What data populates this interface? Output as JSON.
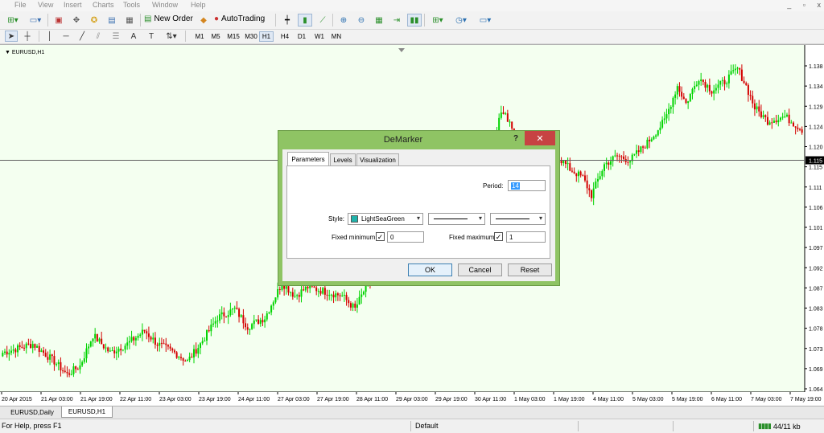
{
  "menu": [
    "File",
    "View",
    "Insert",
    "Charts",
    "Tools",
    "Window",
    "Help"
  ],
  "window_controls": [
    "_",
    "▫",
    "x"
  ],
  "toolbar": {
    "new_order_label": "New Order",
    "autotrading_label": "AutoTrading"
  },
  "timeframes": [
    "M1",
    "M5",
    "M15",
    "M30",
    "H1",
    "H4",
    "D1",
    "W1",
    "MN"
  ],
  "active_timeframe": "H1",
  "chart": {
    "label": "EURUSD,H1",
    "current_price": "1.115",
    "x_labels": [
      "20 Apr 2015",
      "21 Apr 03:00",
      "21 Apr 19:00",
      "22 Apr 11:00",
      "23 Apr 03:00",
      "23 Apr 19:00",
      "24 Apr 11:00",
      "27 Apr 03:00",
      "27 Apr 19:00",
      "28 Apr 11:00",
      "29 Apr 03:00",
      "29 Apr 19:00",
      "30 Apr 11:00",
      "1 May 03:00",
      "1 May 19:00",
      "4 May 11:00",
      "5 May 03:00",
      "5 May 19:00",
      "6 May 11:00",
      "7 May 03:00",
      "7 May 19:00"
    ],
    "y_labels": [
      "1.138",
      "1.134",
      "1.129",
      "1.124",
      "1.120",
      "1.115",
      "1.111",
      "1.106",
      "1.101",
      "1.097",
      "1.092",
      "1.087",
      "1.083",
      "1.078",
      "1.073",
      "1.069",
      "1.064"
    ],
    "colors": {
      "background": "#f4fff0",
      "bull": "#00d400",
      "bear": "#d40000",
      "grid": "#606060"
    }
  },
  "chart_data": {
    "type": "candlestick",
    "symbol": "EURUSD",
    "timeframe": "H1",
    "ylim": [
      1.062,
      1.141
    ],
    "current_price": 1.115,
    "anchors_close": [
      [
        0,
        1.071
      ],
      [
        14,
        1.073
      ],
      [
        24,
        1.069
      ],
      [
        30,
        1.066
      ],
      [
        36,
        1.068
      ],
      [
        42,
        1.075
      ],
      [
        50,
        1.071
      ],
      [
        58,
        1.073
      ],
      [
        66,
        1.076
      ],
      [
        72,
        1.073
      ],
      [
        80,
        1.071
      ],
      [
        86,
        1.069
      ],
      [
        92,
        1.073
      ],
      [
        100,
        1.079
      ],
      [
        108,
        1.081
      ],
      [
        114,
        1.077
      ],
      [
        122,
        1.079
      ],
      [
        130,
        1.087
      ],
      [
        136,
        1.084
      ],
      [
        142,
        1.086
      ],
      [
        150,
        1.085
      ],
      [
        158,
        1.084
      ],
      [
        164,
        1.081
      ],
      [
        170,
        1.087
      ],
      [
        176,
        1.089
      ],
      [
        182,
        1.09
      ],
      [
        190,
        1.091
      ],
      [
        200,
        1.099
      ],
      [
        210,
        1.104
      ],
      [
        218,
        1.112
      ],
      [
        228,
        1.119
      ],
      [
        232,
        1.126
      ],
      [
        236,
        1.124
      ],
      [
        240,
        1.119
      ],
      [
        246,
        1.117
      ],
      [
        252,
        1.114
      ],
      [
        258,
        1.116
      ],
      [
        264,
        1.113
      ],
      [
        270,
        1.111
      ],
      [
        274,
        1.107
      ],
      [
        280,
        1.114
      ],
      [
        286,
        1.116
      ],
      [
        292,
        1.115
      ],
      [
        300,
        1.119
      ],
      [
        308,
        1.124
      ],
      [
        314,
        1.132
      ],
      [
        318,
        1.128
      ],
      [
        324,
        1.134
      ],
      [
        330,
        1.131
      ],
      [
        336,
        1.133
      ],
      [
        342,
        1.136
      ],
      [
        346,
        1.132
      ],
      [
        350,
        1.127
      ],
      [
        356,
        1.124
      ],
      [
        364,
        1.125
      ],
      [
        372,
        1.122
      ]
    ]
  },
  "dialog": {
    "title": "DeMarker",
    "help": "?",
    "tabs": [
      "Parameters",
      "Levels",
      "Visualization"
    ],
    "active_tab": "Parameters",
    "period_label": "Period:",
    "period_value": "14",
    "style_label": "Style:",
    "style_color_name": "LightSeaGreen",
    "style_color": "#20b2aa",
    "fixed_min_label": "Fixed minimum",
    "fixed_min_checked": true,
    "fixed_min_value": "0",
    "fixed_max_label": "Fixed maximum",
    "fixed_max_checked": true,
    "fixed_max_value": "1",
    "ok_label": "OK",
    "cancel_label": "Cancel",
    "reset_label": "Reset"
  },
  "chart_tabs": [
    "EURUSD,Daily",
    "EURUSD,H1"
  ],
  "active_chart_tab": "EURUSD,H1",
  "status": {
    "help_text": "For Help, press F1",
    "profile": "Default",
    "traffic": "44/11 kb"
  }
}
